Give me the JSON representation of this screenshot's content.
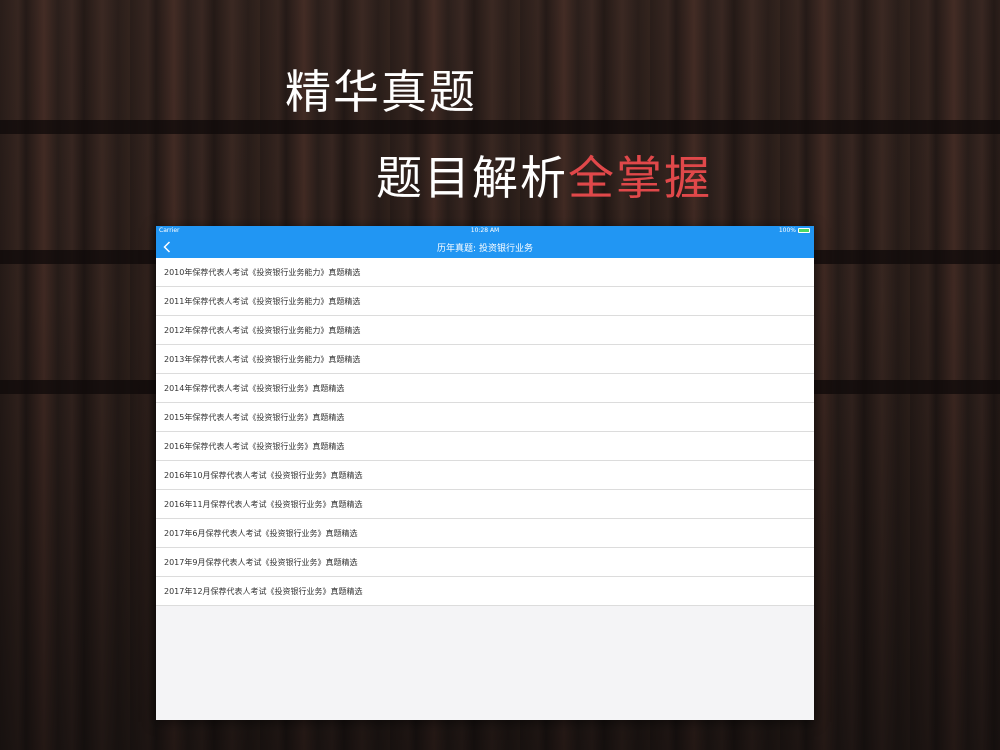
{
  "headline": {
    "line1": "精华真题",
    "line2_main": "题目解析",
    "line2_accent": "全掌握",
    "accent_color": "#e0484a"
  },
  "device": {
    "status_bar": {
      "carrier": "Carrier",
      "time": "10:28 AM",
      "battery": "100%"
    },
    "nav": {
      "back_icon": "chevron-left-icon",
      "title": "历年真题: 投资银行业务",
      "color": "#2196f3"
    },
    "list_items": [
      "2010年保荐代表人考试《投资银行业务能力》真题精选",
      "2011年保荐代表人考试《投资银行业务能力》真题精选",
      "2012年保荐代表人考试《投资银行业务能力》真题精选",
      "2013年保荐代表人考试《投资银行业务能力》真题精选",
      "2014年保荐代表人考试《投资银行业务》真题精选",
      "2015年保荐代表人考试《投资银行业务》真题精选",
      "2016年保荐代表人考试《投资银行业务》真题精选",
      "2016年10月保荐代表人考试《投资银行业务》真题精选",
      "2016年11月保荐代表人考试《投资银行业务》真题精选",
      "2017年6月保荐代表人考试《投资银行业务》真题精选",
      "2017年9月保荐代表人考试《投资银行业务》真题精选",
      "2017年12月保荐代表人考试《投资银行业务》真题精选"
    ]
  }
}
